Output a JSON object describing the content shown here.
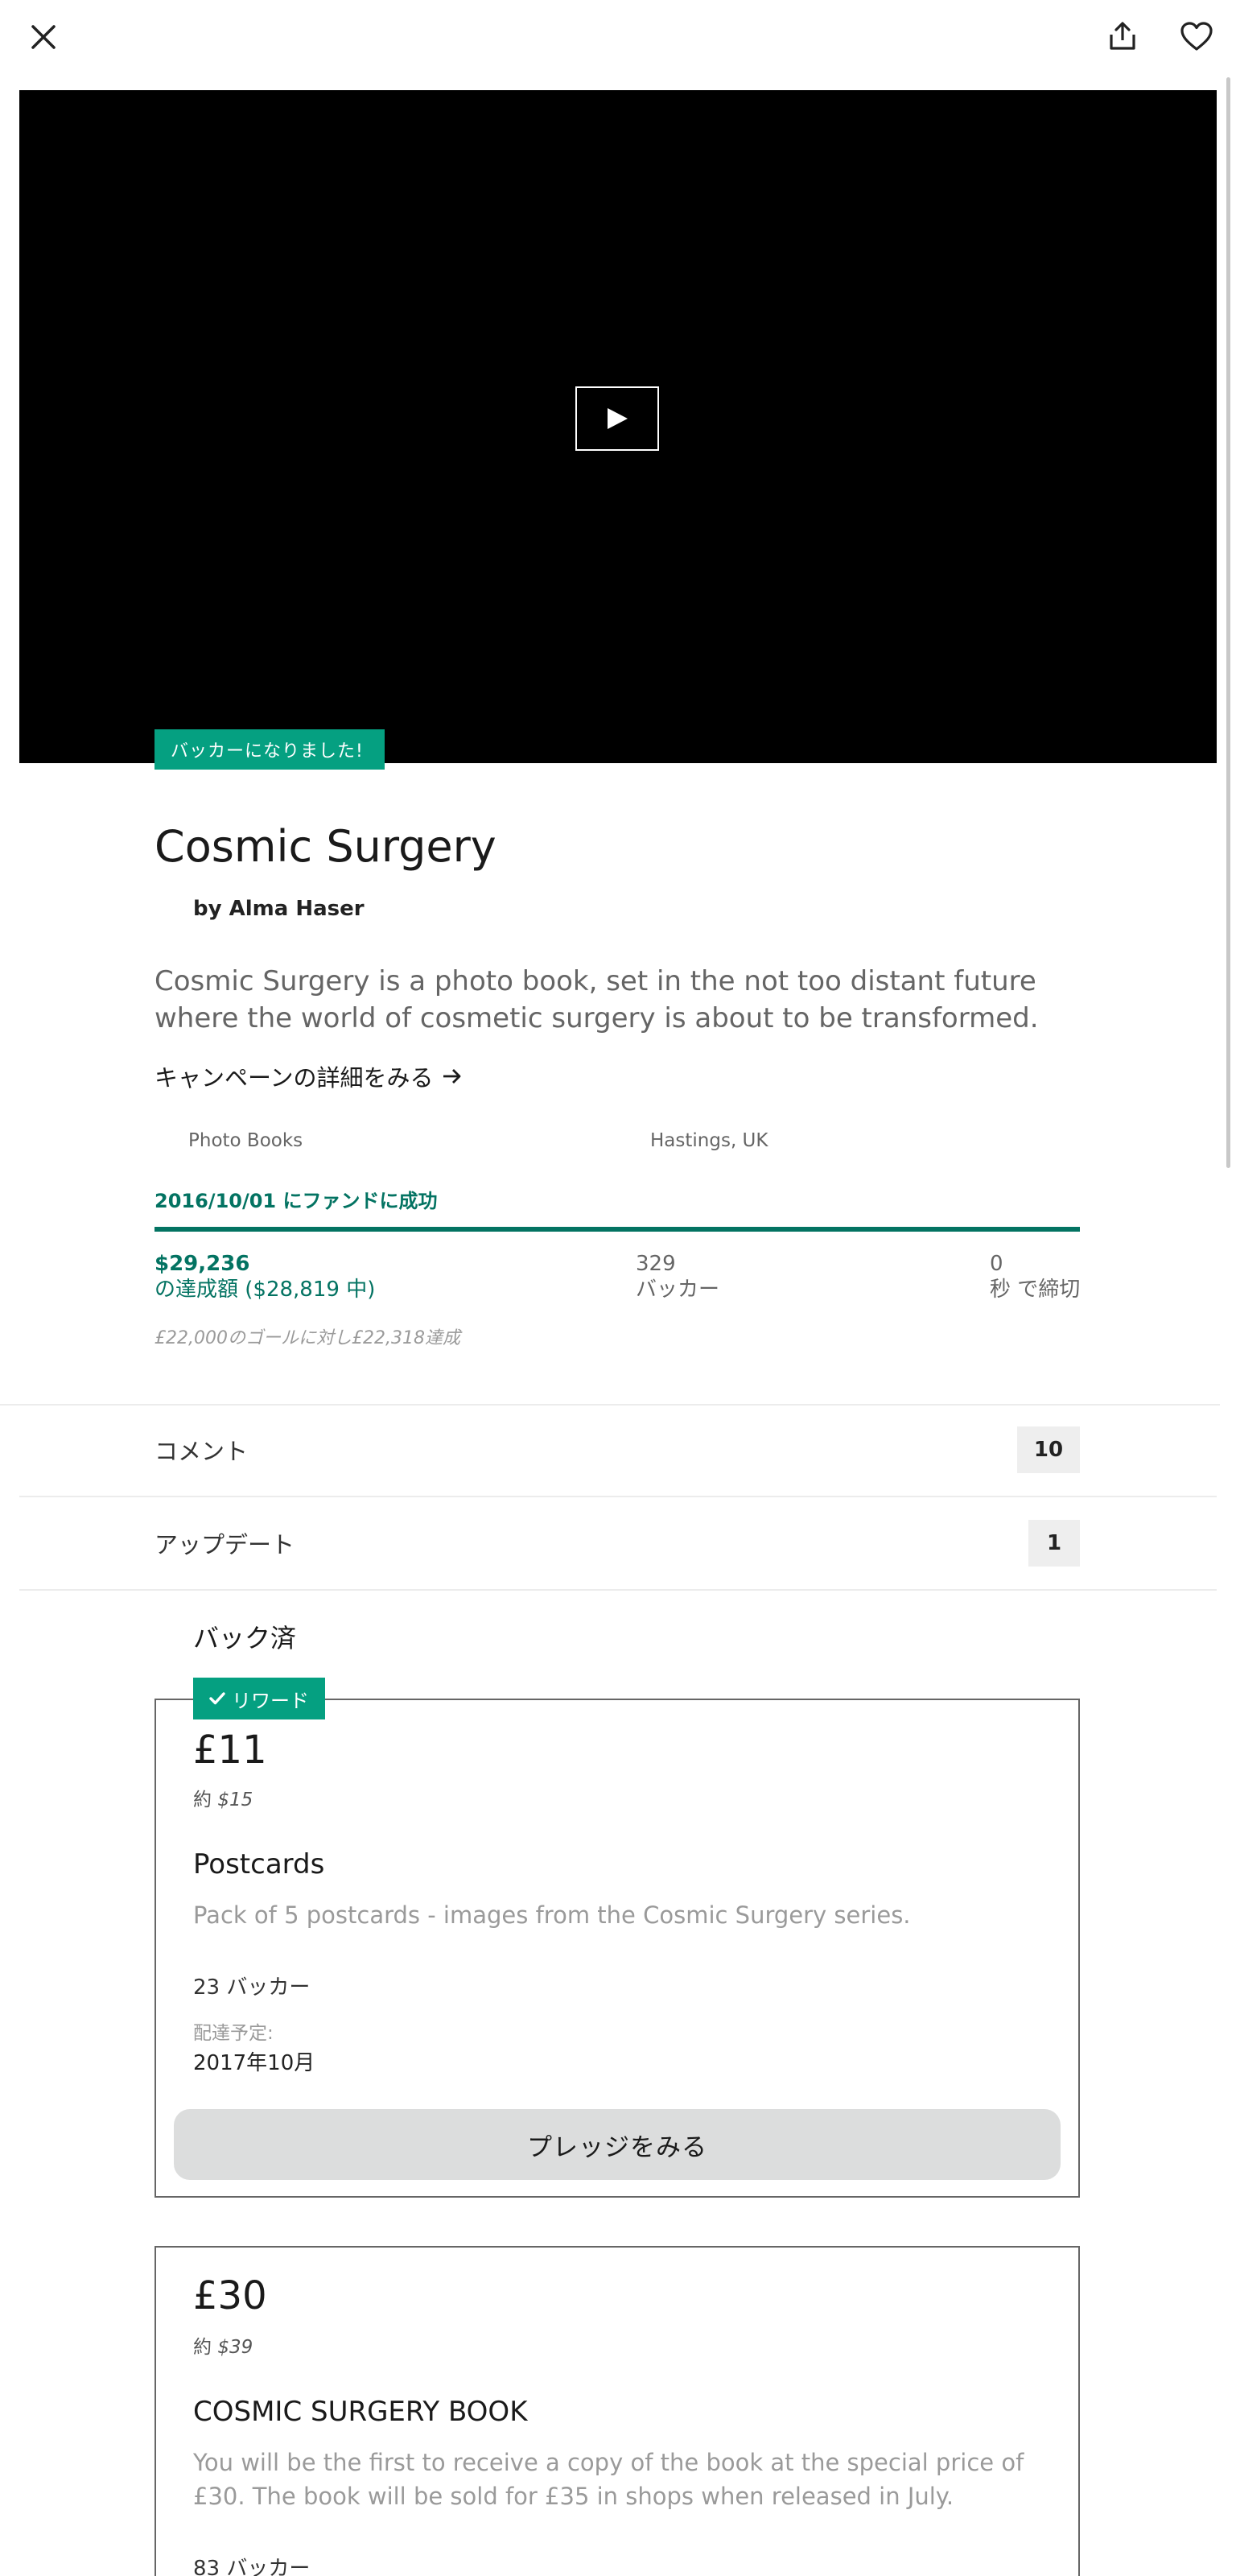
{
  "project": {
    "backed_badge": "バッカーになりました!",
    "title": "Cosmic Surgery",
    "byline": "by Alma Haser",
    "blurb": "Cosmic Surgery is a photo book, set in the not too distant future where the world of cosmetic surgery is about to be transformed.",
    "details_link": "キャンペーンの詳細をみる",
    "category": "Photo Books",
    "location": "Hastings, UK",
    "funded_status": "2016/10/01 にファンドに成功",
    "progress_fraction": 1.0
  },
  "stats": {
    "pledged_value": "$29,236",
    "pledged_label": "の達成額 ($28,819 中)",
    "backers_value": "329",
    "backers_label": "バッカー",
    "time_value": "0",
    "time_label": "秒 で締切",
    "goal_note": "£22,000のゴールに対し£22,318達成"
  },
  "rows": {
    "comments_label": "コメント",
    "comments_count": "10",
    "updates_label": "アップデート",
    "updates_count": "1"
  },
  "rewards_section": {
    "heading": "バック済",
    "selected_tag": "リワード"
  },
  "rewards": [
    {
      "price": "£11",
      "approx_prefix": "約",
      "approx_value": "$15",
      "title": "Postcards",
      "description": "Pack of 5 postcards - images from the Cosmic Surgery series.",
      "backers": "23 バッカー",
      "delivery_label": "配達予定:",
      "delivery_value": "2017年10月",
      "button": "プレッジをみる"
    },
    {
      "price": "£30",
      "approx_prefix": "約",
      "approx_value": "$39",
      "title": "COSMIC SURGERY BOOK",
      "description": "You will be the first to receive a copy of the book at the special price of £30. The book will be sold for £35 in shops when released in July.",
      "backers": "83 バッカー"
    }
  ],
  "icons": {
    "close": "close-icon",
    "share": "share-icon",
    "favorite": "heart-icon",
    "play": "play-icon",
    "arrow": "arrow-right-icon",
    "check": "check-icon"
  },
  "colors": {
    "accent_green": "#05a081",
    "dark_green": "#037362",
    "muted_text": "#656565"
  }
}
